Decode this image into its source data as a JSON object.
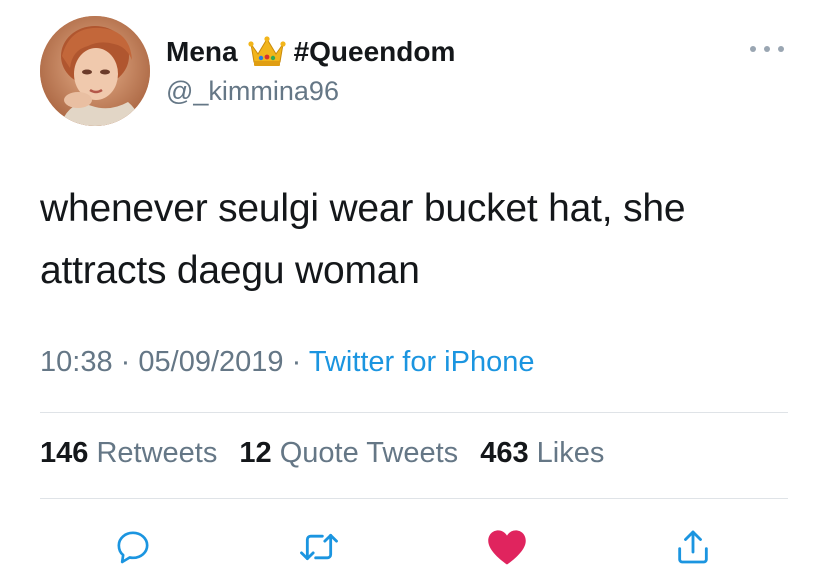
{
  "author": {
    "name": "Mena",
    "crown_emoji": "crown-icon",
    "hashtag": "#Queendom",
    "handle": "@_kimmina96"
  },
  "tweet": {
    "text": "whenever seulgi wear bucket hat, she attracts daegu woman",
    "time": "10:38",
    "date": "05/09/2019",
    "source": "Twitter for iPhone",
    "separator": "·"
  },
  "stats": {
    "retweets_count": "146",
    "retweets_label": "Retweets",
    "quotes_count": "12",
    "quotes_label": "Quote Tweets",
    "likes_count": "463",
    "likes_label": "Likes"
  },
  "actions": {
    "reply": "reply-icon",
    "retweet": "retweet-icon",
    "like": "heart-icon",
    "share": "share-icon"
  },
  "colors": {
    "text": "#14171a",
    "secondary": "#657786",
    "link": "#1b95e0",
    "like": "#e0245e",
    "divider": "#dfe3e7"
  }
}
